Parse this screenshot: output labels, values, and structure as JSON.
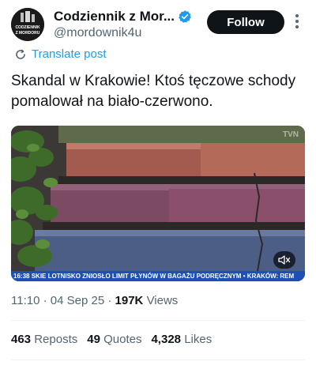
{
  "account": {
    "display_name": "Codziennik z Mor...",
    "handle": "@mordownik4u",
    "avatar_text_line1": "CODZIENNIK",
    "avatar_text_line2": "Z MORDORU"
  },
  "follow_label": "Follow",
  "translate_label": "Translate post",
  "tweet_text": "Skandal w Krakowie! Ktoś tęczowe schody pomalował na biało-czerwono.",
  "media": {
    "ticker_time": "16:38",
    "ticker_text": "SKIE LOTNISKO ZNIOSŁO LIMIT PŁYNÓW W BAGAŻU PODRĘCZNYM",
    "ticker_bullet": "•",
    "ticker_tail": "KRAKÓW: REM",
    "channel": "TVN"
  },
  "meta": {
    "time": "11:10",
    "separator1": "·",
    "date": "04 Sep 25",
    "separator2": "·",
    "views_count": "197K",
    "views_label": "Views"
  },
  "stats": {
    "reposts_count": "463",
    "reposts_label": "Reposts",
    "quotes_count": "49",
    "quotes_label": "Quotes",
    "likes_count": "4,328",
    "likes_label": "Likes"
  },
  "colors": {
    "accent": "#1d9bf0",
    "text": "#0f1419",
    "muted": "#536471",
    "ticker": "#1f4fb5"
  }
}
